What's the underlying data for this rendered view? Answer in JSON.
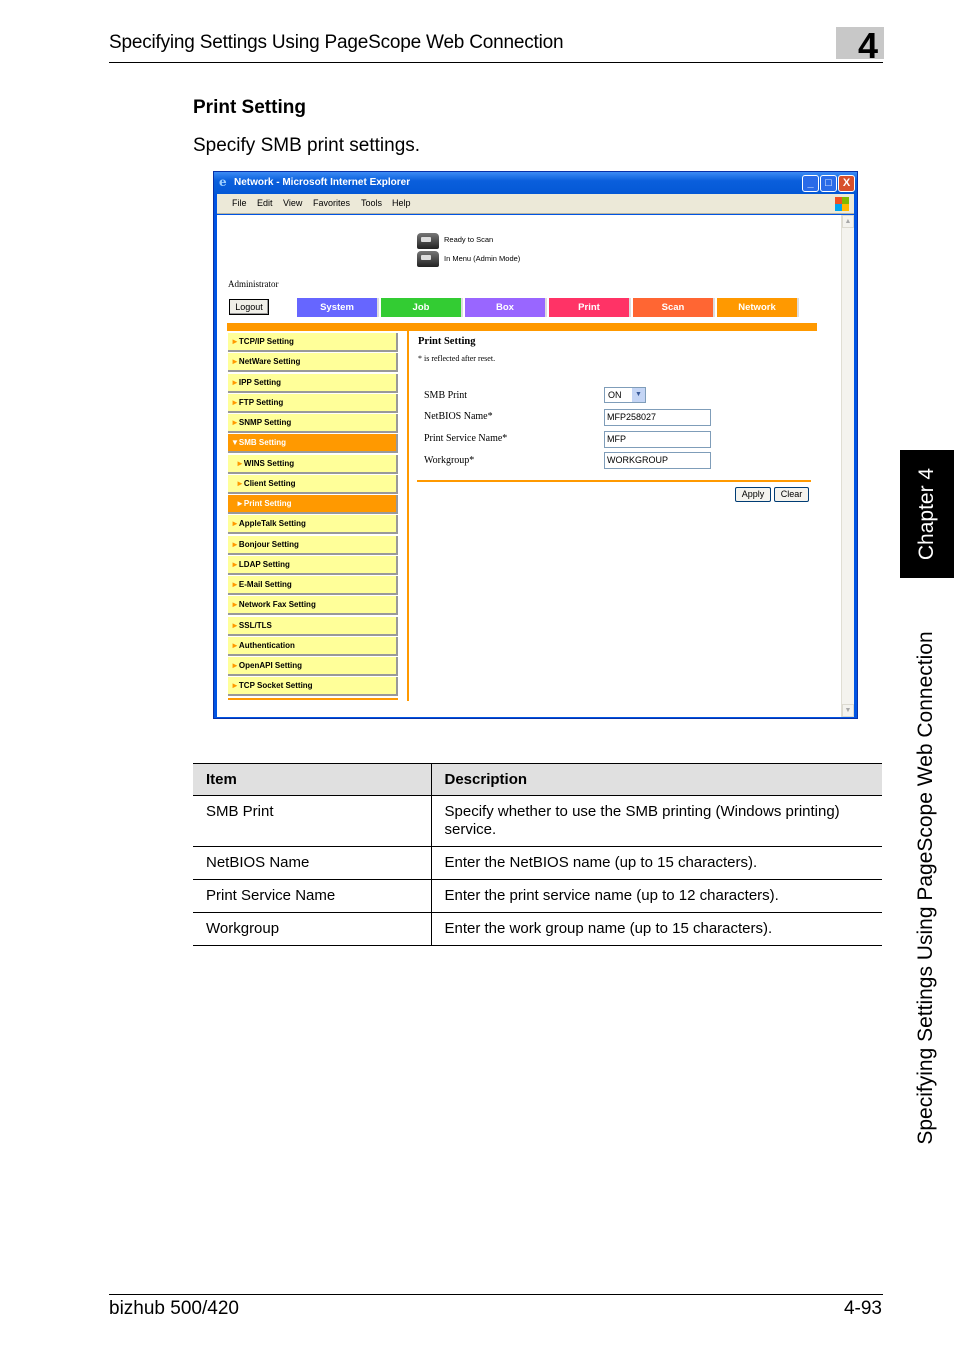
{
  "page_header": {
    "title": "Specifying Settings Using PageScope Web Connection",
    "chapter_number": "4"
  },
  "section": {
    "title": "Print Setting",
    "intro": "Specify SMB print settings."
  },
  "side_tab": {
    "chapter": "Chapter 4",
    "title": "Specifying Settings Using PageScope Web Connection"
  },
  "browser": {
    "title": "Network - Microsoft Internet Explorer",
    "window_buttons": {
      "minimize": "_",
      "maximize": "□",
      "close": "X"
    },
    "menu": [
      "File",
      "Edit",
      "View",
      "Favorites",
      "Tools",
      "Help"
    ],
    "status": [
      {
        "icon": "scanner-icon",
        "text": "Ready to Scan"
      },
      {
        "icon": "printer-icon",
        "text": "In Menu (Admin Mode)"
      }
    ],
    "user_label": "Administrator",
    "logout_label": "Logout",
    "tabs": [
      {
        "label": "System",
        "color": "#6666ff"
      },
      {
        "label": "Job",
        "color": "#33cc33"
      },
      {
        "label": "Box",
        "color": "#9966ff"
      },
      {
        "label": "Print",
        "color": "#ff3366"
      },
      {
        "label": "Scan",
        "color": "#ff6633"
      },
      {
        "label": "Network",
        "color": "#ff9900"
      }
    ],
    "active_tab": "Network",
    "nav": [
      {
        "label": "TCP/IP Setting",
        "arrow": "►"
      },
      {
        "label": "NetWare Setting",
        "arrow": "►"
      },
      {
        "label": "IPP Setting",
        "arrow": "►"
      },
      {
        "label": "FTP Setting",
        "arrow": "►"
      },
      {
        "label": "SNMP Setting",
        "arrow": "►"
      },
      {
        "label": "SMB Setting",
        "arrow": "▼"
      },
      {
        "label": "WINS Setting",
        "arrow": "►"
      },
      {
        "label": "Client Setting",
        "arrow": "►"
      },
      {
        "label": "Print Setting",
        "arrow": "►"
      },
      {
        "label": "AppleTalk Setting",
        "arrow": "►"
      },
      {
        "label": "Bonjour Setting",
        "arrow": "►"
      },
      {
        "label": "LDAP Setting",
        "arrow": "►"
      },
      {
        "label": "E-Mail Setting",
        "arrow": "►"
      },
      {
        "label": "Network Fax Setting",
        "arrow": "►"
      },
      {
        "label": "SSL/TLS",
        "arrow": "►"
      },
      {
        "label": "Authentication",
        "arrow": "►"
      },
      {
        "label": "OpenAPI Setting",
        "arrow": "►"
      },
      {
        "label": "TCP Socket Setting",
        "arrow": "►"
      }
    ],
    "form": {
      "title": "Print Setting",
      "note": "* is reflected after reset.",
      "smb_print_label": "SMB Print",
      "smb_print_value": "ON",
      "netbios_label": "NetBIOS Name*",
      "netbios_value": "MFP258027",
      "print_service_label": "Print Service Name*",
      "print_service_value": "MFP",
      "workgroup_label": "Workgroup*",
      "workgroup_value": "WORKGROUP",
      "apply_label": "Apply",
      "clear_label": "Clear"
    }
  },
  "table": {
    "headers": [
      "Item",
      "Description"
    ],
    "rows": [
      [
        "SMB Print",
        "Specify whether to use the SMB printing (Windows printing) service."
      ],
      [
        "NetBIOS Name",
        "Enter the NetBIOS name (up to 15 characters)."
      ],
      [
        "Print Service Name",
        "Enter the print service name (up to 12 characters)."
      ],
      [
        "Workgroup",
        "Enter the work group name (up to 15 characters)."
      ]
    ]
  },
  "footer": {
    "product": "bizhub 500/420",
    "page": "4-93"
  }
}
